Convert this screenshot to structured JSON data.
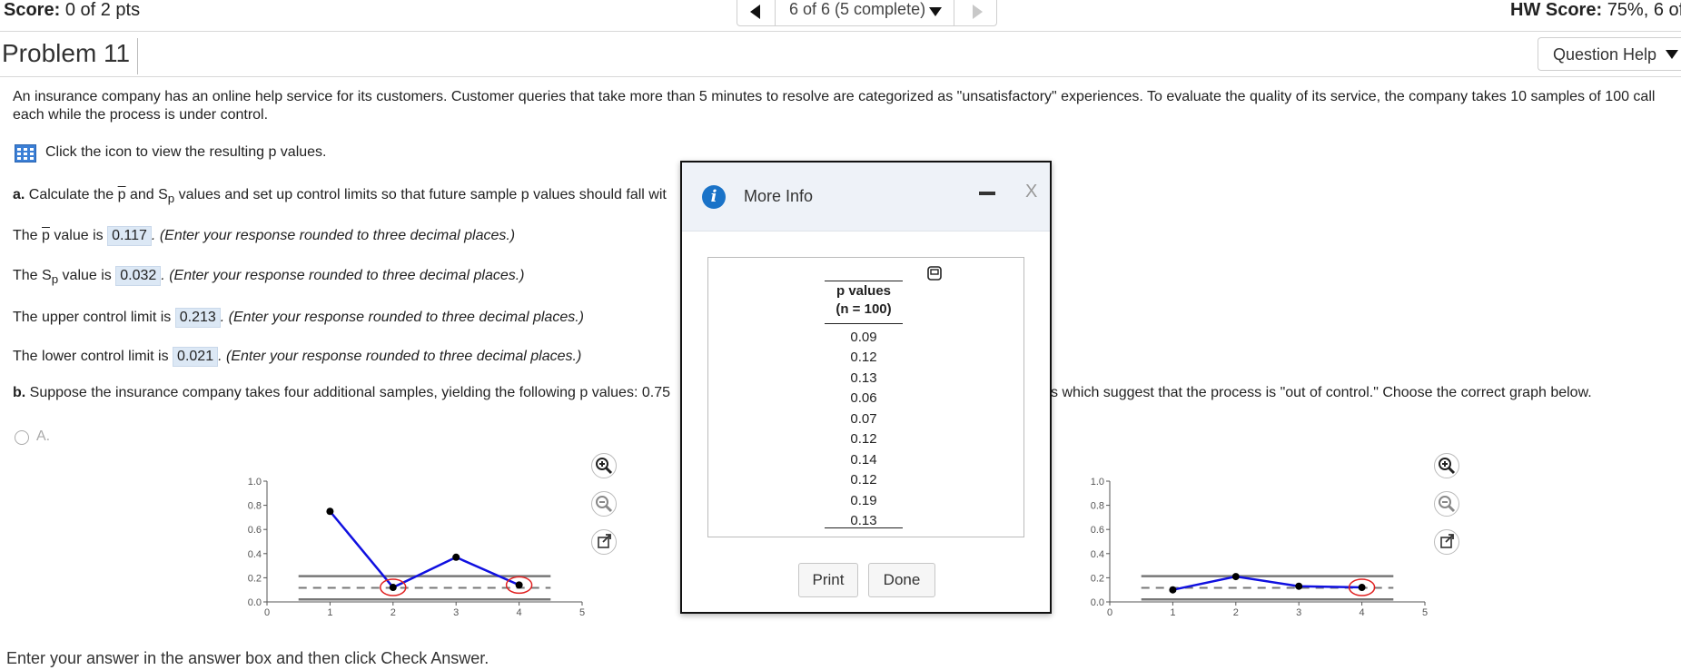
{
  "header": {
    "score_label": "Score:",
    "score_value": "0 of 2 pts",
    "nav_label": "6 of 6 (5 complete)",
    "hw_score_label": "HW Score:",
    "hw_score_value": "75%, 6 of"
  },
  "problem": {
    "title": "Problem 11",
    "question_help": "Question Help"
  },
  "intro": {
    "line1": "An insurance company has an online help service for its customers. Customer queries that take more than 5 minutes to resolve are categorized as \"unsatisfactory\" experiences. To evaluate the quality of its service, the company takes 10 samples of 100 call",
    "line2": "each while the process is under control."
  },
  "click_icon_text": "Click the icon to view the resulting p values.",
  "part_a": {
    "label": "a.",
    "text_before": " Calculate the ",
    "p_symbol": "p",
    "text_mid": " and S",
    "subscript": "p",
    "text_after": " values and set up control limits so that future sample p values should fall wit",
    "pbar": {
      "prefix": "The ",
      "symbol": "p",
      "mid": " value is ",
      "answer": "0.117",
      "note": ". (Enter your response rounded to three decimal places.)"
    },
    "sp": {
      "prefix": "The S",
      "sub": "p",
      "mid": " value is ",
      "answer": "0.032",
      "note": ". (Enter your response rounded to three decimal places.)"
    },
    "ucl": {
      "prefix": "The upper control limit is ",
      "answer": "0.213",
      "note": ". (Enter your response rounded to three decimal places.)"
    },
    "lcl": {
      "prefix": "The lower control limit is ",
      "answer": "0.021",
      "note": ". (Enter your response rounded to three decimal places.)"
    }
  },
  "part_b": {
    "label": "b.",
    "text_left": " Suppose the insurance company takes four additional samples, yielding the following p values: 0.75",
    "text_right": "s which suggest that the process is \"out of control.\" Choose the correct graph below."
  },
  "option_a_label": "A.",
  "footer": "Enter your answer in the answer box and then click Check Answer.",
  "modal": {
    "title": "More Info",
    "close": "X",
    "table_header_1": "p values",
    "table_header_2": "(n = 100)",
    "p_values": [
      "0.09",
      "0.12",
      "0.13",
      "0.06",
      "0.07",
      "0.12",
      "0.14",
      "0.12",
      "0.19",
      "0.13"
    ],
    "print_button": "Print",
    "done_button": "Done"
  },
  "chart_data": [
    {
      "type": "line",
      "x": [
        1,
        2,
        3,
        4
      ],
      "y": [
        0.75,
        0.12,
        0.37,
        0.14
      ],
      "circled_x": [
        2,
        4
      ],
      "ucl": 0.213,
      "center": 0.117,
      "lcl": 0.021,
      "xlim": [
        0,
        5
      ],
      "ylim": [
        0,
        1.0
      ],
      "x_ticks": [
        "0",
        "1",
        "2",
        "3",
        "4",
        "5"
      ],
      "y_ticks": [
        "0.0",
        "0.2",
        "0.4",
        "0.6",
        "0.8",
        "1.0"
      ],
      "line_color": "#1010e0",
      "circle_color": "#e02020"
    },
    {
      "type": "line",
      "x": [
        1,
        2,
        3,
        4
      ],
      "y": [
        0.1,
        0.21,
        0.13,
        0.12
      ],
      "circled_x": [
        4
      ],
      "ucl": 0.213,
      "center": 0.117,
      "lcl": 0.021,
      "xlim": [
        0,
        5
      ],
      "ylim": [
        0,
        1.0
      ],
      "x_ticks": [
        "0",
        "1",
        "2",
        "3",
        "4",
        "5"
      ],
      "y_ticks": [
        "0.0",
        "0.2",
        "0.4",
        "0.6",
        "0.8",
        "1.0"
      ],
      "line_color": "#1010e0",
      "circle_color": "#e02020"
    }
  ]
}
